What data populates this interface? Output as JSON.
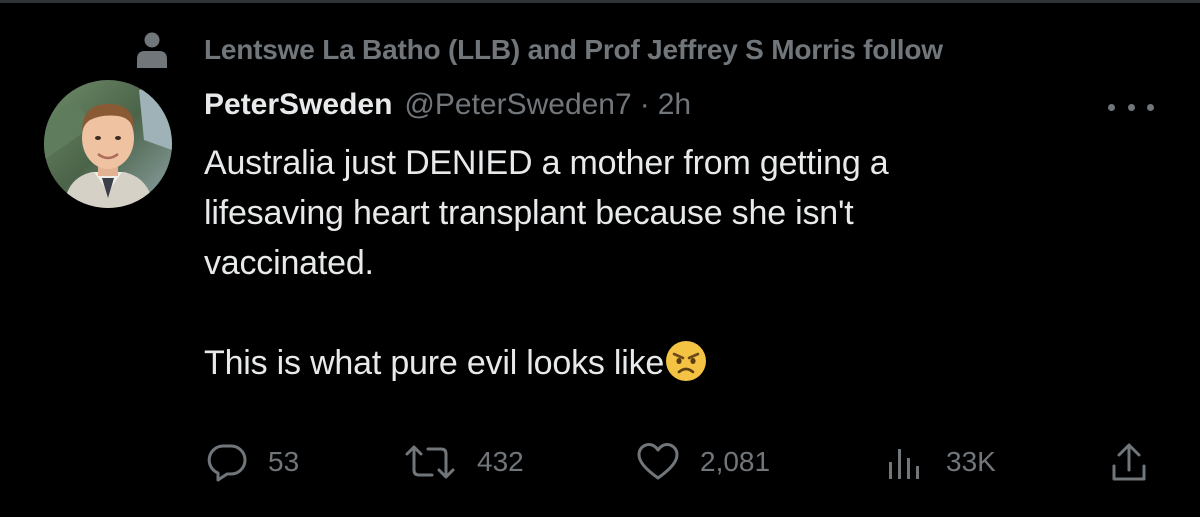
{
  "social_context": {
    "icon": "person-icon",
    "text": "Lentswe La Batho (LLB) and Prof Jeffrey S Morris follow"
  },
  "author": {
    "display_name": "PeterSweden",
    "handle": "@PeterSweden7",
    "separator": "·",
    "time": "2h"
  },
  "tweet": {
    "lines": [
      "Australia just DENIED a mother from getting a",
      "lifesaving heart transplant because she isn't",
      "vaccinated.",
      "",
      "This is what pure evil looks like"
    ],
    "emoji": "angry-face-emoji"
  },
  "actions": {
    "reply": {
      "icon": "reply-icon",
      "count": "53"
    },
    "retweet": {
      "icon": "retweet-icon",
      "count": "432"
    },
    "like": {
      "icon": "heart-icon",
      "count": "2,081"
    },
    "views": {
      "icon": "views-icon",
      "count": "33K"
    },
    "share": {
      "icon": "share-icon"
    }
  },
  "colors": {
    "background": "#000000",
    "primary_text": "#e7e9ea",
    "secondary_text": "#71767b"
  }
}
